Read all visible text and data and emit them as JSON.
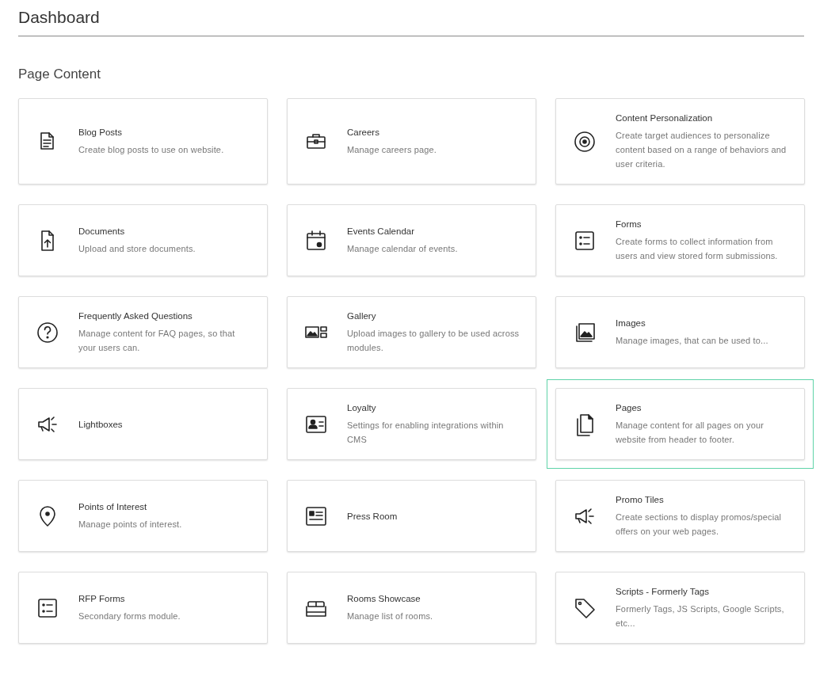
{
  "page": {
    "title": "Dashboard"
  },
  "section": {
    "title": "Page Content"
  },
  "cards": [
    {
      "title": "Blog Posts",
      "description": "Create blog posts to use on website.",
      "selected": false
    },
    {
      "title": "Careers",
      "description": "Manage careers page.",
      "selected": false
    },
    {
      "title": "Content Personalization",
      "description": "Create target audiences to personalize content based on a range of behaviors and user criteria.",
      "selected": false
    },
    {
      "title": "Documents",
      "description": "Upload and store documents.",
      "selected": false
    },
    {
      "title": "Events Calendar",
      "description": "Manage calendar of events.",
      "selected": false
    },
    {
      "title": "Forms",
      "description": "Create forms to collect information from users and view stored form submissions.",
      "selected": false
    },
    {
      "title": "Frequently Asked Questions",
      "description": "Manage content for FAQ pages, so that your users can.",
      "selected": false
    },
    {
      "title": "Gallery",
      "description": "Upload images to gallery to be used across modules.",
      "selected": false
    },
    {
      "title": "Images",
      "description": "Manage images, that can be used to...",
      "selected": false
    },
    {
      "title": "Lightboxes",
      "selected": false
    },
    {
      "title": "Loyalty",
      "description": "Settings for enabling integrations within CMS",
      "selected": false
    },
    {
      "title": "Pages",
      "description": "Manage content for all pages on your website from header to footer.",
      "selected": true
    },
    {
      "title": "Points of Interest",
      "description": "Manage points of interest.",
      "selected": false
    },
    {
      "title": "Press Room",
      "selected": false
    },
    {
      "title": "Promo Tiles",
      "description": "Create sections to display promos/special offers on your web pages.",
      "selected": false
    },
    {
      "title": "RFP Forms",
      "description": "Secondary forms module.",
      "selected": false
    },
    {
      "title": "Rooms Showcase",
      "description": "Manage list of rooms.",
      "selected": false
    },
    {
      "title": "Scripts - Formerly Tags",
      "description": "Formerly Tags, JS Scripts, Google Scripts, etc...",
      "selected": false
    }
  ]
}
